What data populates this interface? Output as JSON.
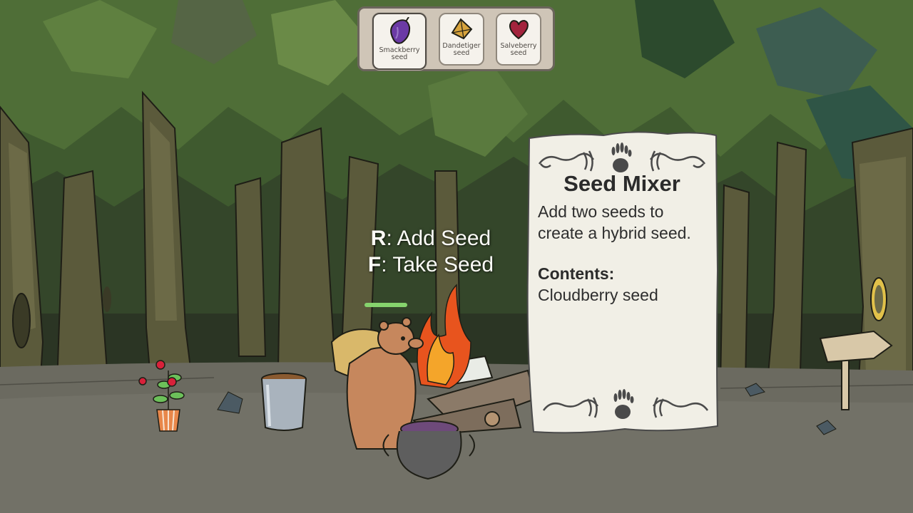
{
  "inventory": {
    "slots": [
      {
        "label": "Smackberry seed",
        "icon": "smackberry-seed-icon",
        "color": "#6b3aa5",
        "selected": true
      },
      {
        "label": "Dandetiger seed",
        "icon": "dandetiger-seed-icon",
        "color": "#d7a33c",
        "selected": false
      },
      {
        "label": "Salveberry seed",
        "icon": "salveberry-seed-icon",
        "color": "#a3243d",
        "selected": false
      }
    ]
  },
  "prompt": {
    "add_key": "R",
    "add_action": ": Add Seed",
    "take_key": "F",
    "take_action": ": Take Seed"
  },
  "card": {
    "title": "Seed Mixer",
    "description": "Add two seeds to create a hybrid seed.",
    "contents_label": "Contents:",
    "contents_value": "Cloudberry seed"
  },
  "colors": {
    "ground": "#6b6a60",
    "card_paper": "#f1efe6",
    "card_ink": "#4a4a4a",
    "progress": "#86d36d"
  }
}
